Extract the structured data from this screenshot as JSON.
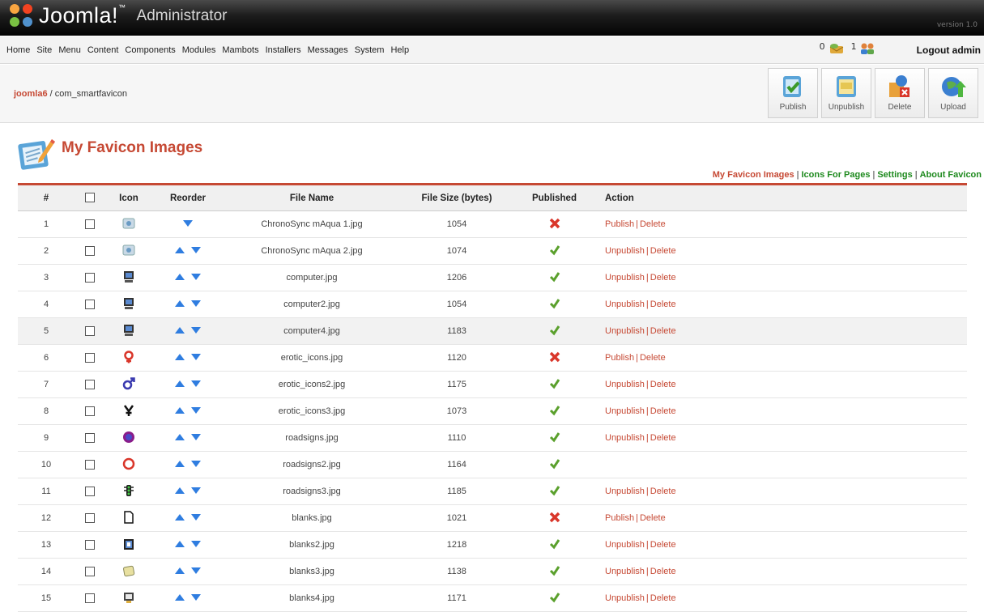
{
  "header": {
    "logo_text": "Joomla!",
    "logo_sub": "Administrator",
    "version": "version 1.0"
  },
  "menu": [
    "Home",
    "Site",
    "Menu",
    "Content",
    "Components",
    "Modules",
    "Mambots",
    "Installers",
    "Messages",
    "System",
    "Help"
  ],
  "status": {
    "messages_count": "0",
    "users_count": "1",
    "logout_label": "Logout admin"
  },
  "breadcrumb": {
    "site": "joomla6",
    "separator": "/",
    "component": "com_smartfavicon"
  },
  "toolbar": {
    "publish": "Publish",
    "unpublish": "Unpublish",
    "delete": "Delete",
    "upload": "Upload"
  },
  "page": {
    "title": "My Favicon Images",
    "subnav": [
      "My Favicon Images",
      "Icons For Pages",
      "Settings",
      "About Favicon"
    ],
    "subnav_separator": "|"
  },
  "table": {
    "headers": {
      "num": "#",
      "icon": "Icon",
      "reorder": "Reorder",
      "file": "File Name",
      "size": "File Size (bytes)",
      "published": "Published",
      "action": "Action"
    },
    "action_labels": {
      "publish": "Publish",
      "unpublish": "Unpublish",
      "delete": "Delete",
      "sep": "|"
    },
    "rows": [
      {
        "num": "1",
        "file": "ChronoSync mAqua 1.jpg",
        "size": "1054",
        "published": false,
        "icon": "chronosync-aqua-icon",
        "up": false,
        "actions": true
      },
      {
        "num": "2",
        "file": "ChronoSync mAqua 2.jpg",
        "size": "1074",
        "published": true,
        "icon": "chronosync-aqua-icon",
        "up": true,
        "actions": true
      },
      {
        "num": "3",
        "file": "computer.jpg",
        "size": "1206",
        "published": true,
        "icon": "computer-icon",
        "up": true,
        "actions": true
      },
      {
        "num": "4",
        "file": "computer2.jpg",
        "size": "1054",
        "published": true,
        "icon": "computer-icon",
        "up": true,
        "actions": true
      },
      {
        "num": "5",
        "file": "computer4.jpg",
        "size": "1183",
        "published": true,
        "icon": "computer-icon",
        "up": true,
        "actions": true
      },
      {
        "num": "6",
        "file": "erotic_icons.jpg",
        "size": "1120",
        "published": false,
        "icon": "female-symbol-icon",
        "up": true,
        "actions": true
      },
      {
        "num": "7",
        "file": "erotic_icons2.jpg",
        "size": "1175",
        "published": true,
        "icon": "male-symbol-icon",
        "up": true,
        "actions": true
      },
      {
        "num": "8",
        "file": "erotic_icons3.jpg",
        "size": "1073",
        "published": true,
        "icon": "figure-icon",
        "up": true,
        "actions": true
      },
      {
        "num": "9",
        "file": "roadsigns.jpg",
        "size": "1110",
        "published": true,
        "icon": "roadsign-circle-icon",
        "up": true,
        "actions": true
      },
      {
        "num": "10",
        "file": "roadsigns2.jpg",
        "size": "1164",
        "published": true,
        "icon": "roadsign-ring-icon",
        "up": true,
        "actions": false
      },
      {
        "num": "11",
        "file": "roadsigns3.jpg",
        "size": "1185",
        "published": true,
        "icon": "traffic-light-icon",
        "up": true,
        "actions": true
      },
      {
        "num": "12",
        "file": "blanks.jpg",
        "size": "1021",
        "published": false,
        "icon": "blank-page-icon",
        "up": true,
        "actions": true
      },
      {
        "num": "13",
        "file": "blanks2.jpg",
        "size": "1218",
        "published": true,
        "icon": "blank-doc-icon",
        "up": true,
        "actions": true
      },
      {
        "num": "14",
        "file": "blanks3.jpg",
        "size": "1138",
        "published": true,
        "icon": "blank-note-icon",
        "up": true,
        "actions": true
      },
      {
        "num": "15",
        "file": "blanks4.jpg",
        "size": "1171",
        "published": true,
        "icon": "blank-screen-icon",
        "up": true,
        "actions": true
      }
    ]
  },
  "colors": {
    "accent": "#c64934",
    "green_link": "#1e8a1e",
    "check": "#5aa02c",
    "cross": "#d9362a",
    "arrow": "#2f7de0"
  }
}
